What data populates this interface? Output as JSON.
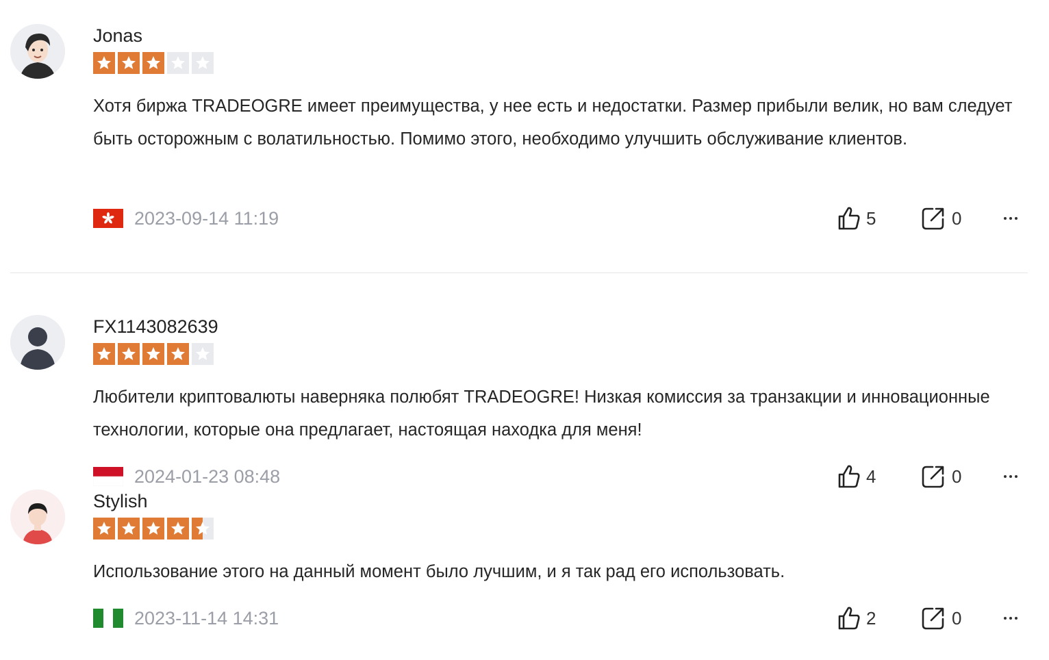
{
  "reviews": [
    {
      "username": "Jonas",
      "rating": 3,
      "text": "Хотя биржа TRADEOGRE имеет преимущества, у нее есть и недостатки. Размер прибыли велик, но вам следует быть осторожным с волатильностью. Помимо этого, необходимо улучшить обслуживание клиентов.",
      "flag": "hong-kong-flag",
      "date": "2023-09-14 11:19",
      "likes": "5",
      "shares": "0"
    },
    {
      "username": "FX1143082639",
      "rating": 4,
      "text": "Любители криптовалюты наверняка полюбят TRADEOGRE! Низкая комиссия за транзакции и инновационные технологии, которые она предлагает, настоящая находка для меня!",
      "flag": "indonesia-flag",
      "date": "2024-01-23 08:48",
      "likes": "4",
      "shares": "0"
    },
    {
      "username": "Stylish",
      "rating": 4.5,
      "text": "Использование этого на данный момент было лучшим, и я так рад его использовать.",
      "flag": "nigeria-flag",
      "date": "2023-11-14 14:31",
      "likes": "2",
      "shares": "0"
    }
  ],
  "colors": {
    "star_on": "#e07b35",
    "star_off": "#e9eaee",
    "date": "#9b9ea6"
  },
  "icons": {
    "like": "thumbs-up-icon",
    "share": "share-icon",
    "more": "more-icon"
  }
}
